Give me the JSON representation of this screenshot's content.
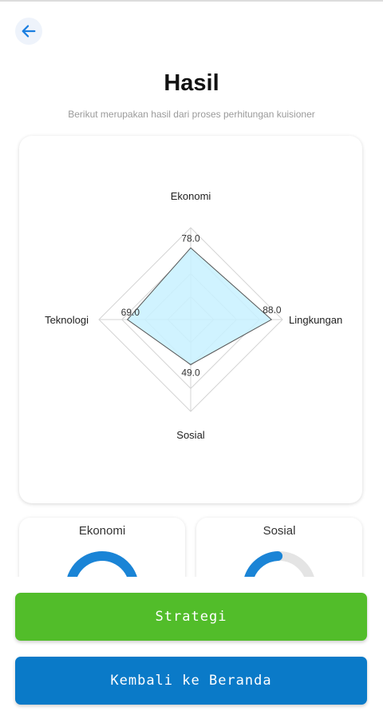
{
  "header": {
    "title": "Hasil",
    "subtitle": "Berikut merupakan hasil dari proses perhitungan kuisioner"
  },
  "icons": {
    "back": "arrow-left-icon"
  },
  "colors": {
    "accent": "#1a7ee0",
    "radar_fill": "#c8f1ff",
    "strategi_button": "#52bd2a",
    "home_button": "#0a7ac8",
    "gauge": "#1a84d6"
  },
  "chart_data": {
    "type": "radar",
    "axes": [
      "Ekonomi",
      "Lingkungan",
      "Sosial",
      "Teknologi"
    ],
    "values": [
      78.0,
      88.0,
      49.0,
      69.0
    ],
    "value_labels": [
      "78.0",
      "88.0",
      "49.0",
      "69.0"
    ],
    "range": [
      0,
      100
    ],
    "grid_levels": 4
  },
  "gauges": [
    {
      "title": "Ekonomi",
      "value": 78.0
    },
    {
      "title": "Sosial",
      "value": 49.0
    }
  ],
  "buttons": {
    "strategi": "Strategi",
    "home": "Kembali ke Beranda"
  }
}
